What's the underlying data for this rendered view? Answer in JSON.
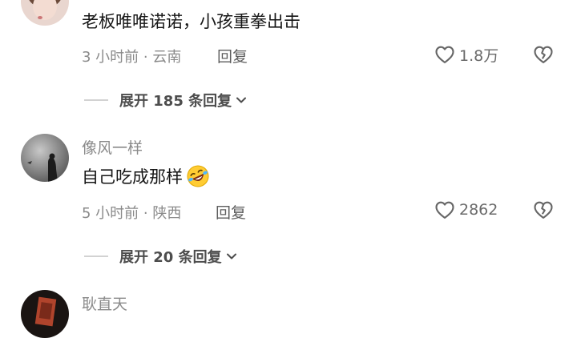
{
  "comments": [
    {
      "text": "老板唯唯诺诺，小孩重拳出击",
      "time": "3 小时前 · 云南",
      "reply_label": "回复",
      "likes": "1.8万",
      "expand_label": "展开 185 条回复"
    },
    {
      "username": "像风一样",
      "text": "自己吃成那样",
      "emoji": "rolling-on-floor-laughing-emoji",
      "time": "5 小时前 · 陕西",
      "reply_label": "回复",
      "likes": "2862",
      "expand_label": "展开 20 条回复"
    },
    {
      "username": "耿直天"
    }
  ],
  "icons": {
    "like": "heart-outline-icon",
    "dislike": "broken-heart-icon",
    "expand": "chevron-down-icon"
  },
  "colors": {
    "text": "#161616",
    "secondary": "#8a8a8a",
    "icon": "#666666"
  }
}
